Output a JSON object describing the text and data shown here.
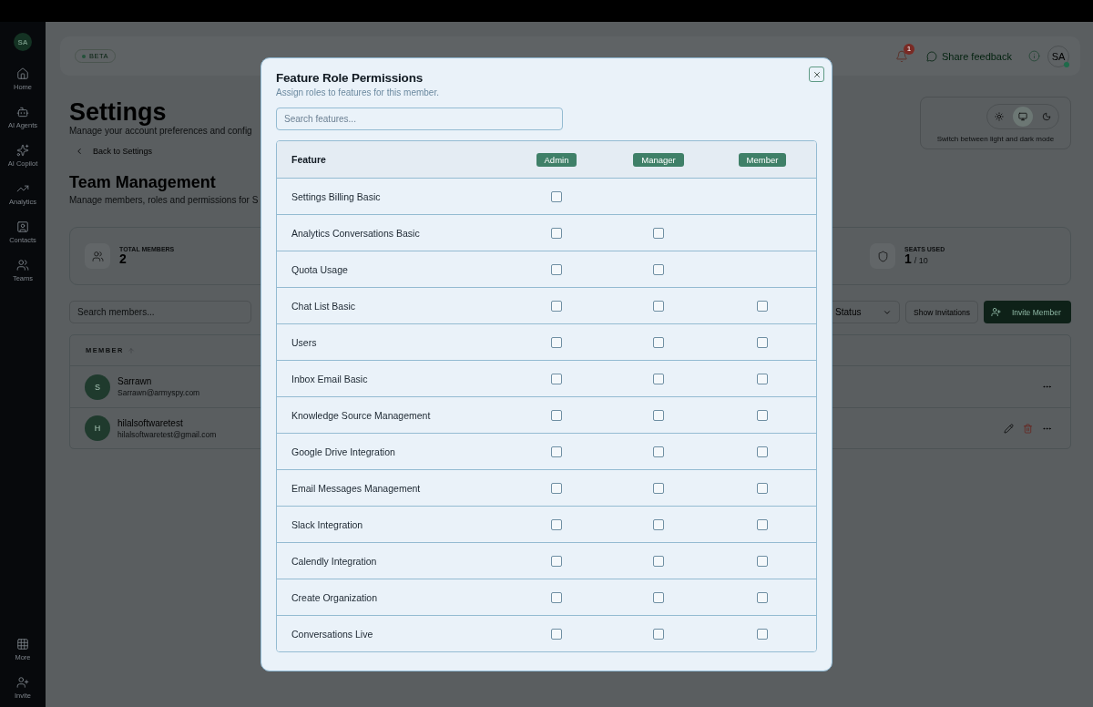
{
  "sidebar": {
    "avatar": "SA",
    "items": [
      {
        "label": "Home"
      },
      {
        "label": "AI Agents"
      },
      {
        "label": "AI Copilot"
      },
      {
        "label": "Analytics"
      },
      {
        "label": "Contacts"
      },
      {
        "label": "Teams"
      }
    ],
    "bottom_items": [
      {
        "label": "More"
      },
      {
        "label": "Invite"
      }
    ]
  },
  "top_bar": {
    "badge": "BETA",
    "notification_count": "1",
    "feedback_button": "Share feedback",
    "avatar": "SA"
  },
  "header": {
    "title": "Settings",
    "subtitle": "Manage your account preferences and config",
    "back_link": "Back to Settings",
    "section_title": "Team Management",
    "section_subtitle": "Manage members, roles and permissions for S"
  },
  "theme_switcher": {
    "options": [
      {
        "selected": false
      },
      {
        "selected": true
      },
      {
        "selected": false
      }
    ],
    "caption": "Switch between light and dark mode"
  },
  "stats": [
    {
      "label": "TOTAL MEMBERS",
      "value": "2"
    },
    {
      "label": "SEATS USED",
      "value": "1",
      "total": "/ 10"
    }
  ],
  "toolbar": {
    "search_placeholder": "Search members...",
    "status_filter": "Status",
    "show_invitations": "Show Invitations",
    "invite_button": "Invite Member"
  },
  "members_table": {
    "column": "MEMBER",
    "rows": [
      {
        "initial": "S",
        "name": "Sarrawn",
        "email": "Sarrawn@armyspy.com",
        "actions_shown": false
      },
      {
        "initial": "H",
        "name": "hilalsoftwaretest",
        "email": "hilalsoftwaretest@gmail.com",
        "actions_shown": true
      }
    ]
  },
  "modal": {
    "title": "Feature Role Permissions",
    "subtitle": "Assign roles to features for this member.",
    "search_placeholder": "Search features...",
    "feature_column": "Feature",
    "roles": [
      "Admin",
      "Manager",
      "Member"
    ],
    "rows": [
      {
        "feature": "Settings Billing Basic",
        "checkboxes": [
          {
            "checked": false
          }
        ]
      },
      {
        "feature": "Analytics Conversations Basic",
        "checkboxes": [
          {
            "checked": false
          },
          {
            "checked": false
          }
        ]
      },
      {
        "feature": "Quota Usage",
        "checkboxes": [
          {
            "checked": false
          },
          {
            "checked": false
          }
        ]
      },
      {
        "feature": "Chat List Basic",
        "checkboxes": [
          {
            "checked": false
          },
          {
            "checked": false
          },
          {
            "checked": false
          }
        ]
      },
      {
        "feature": "Users",
        "checkboxes": [
          {
            "checked": false
          },
          {
            "checked": false
          },
          {
            "checked": false
          }
        ]
      },
      {
        "feature": "Inbox Email Basic",
        "checkboxes": [
          {
            "checked": false
          },
          {
            "checked": false
          },
          {
            "checked": false
          }
        ]
      },
      {
        "feature": "Knowledge Source Management",
        "checkboxes": [
          {
            "checked": false
          },
          {
            "checked": false
          },
          {
            "checked": false
          }
        ]
      },
      {
        "feature": "Google Drive Integration",
        "checkboxes": [
          {
            "checked": false
          },
          {
            "checked": false
          },
          {
            "checked": false
          }
        ]
      },
      {
        "feature": "Email Messages Management",
        "checkboxes": [
          {
            "checked": false
          },
          {
            "checked": false
          },
          {
            "checked": false
          }
        ]
      },
      {
        "feature": "Slack Integration",
        "checkboxes": [
          {
            "checked": false
          },
          {
            "checked": false
          },
          {
            "checked": false
          }
        ]
      },
      {
        "feature": "Calendly Integration",
        "checkboxes": [
          {
            "checked": false
          },
          {
            "checked": false
          },
          {
            "checked": false
          }
        ]
      },
      {
        "feature": "Create Organization",
        "checkboxes": [
          {
            "checked": false
          },
          {
            "checked": false
          },
          {
            "checked": false
          }
        ]
      },
      {
        "feature": "Conversations Live",
        "checkboxes": [
          {
            "checked": false
          },
          {
            "checked": false
          },
          {
            "checked": false
          }
        ]
      }
    ]
  }
}
